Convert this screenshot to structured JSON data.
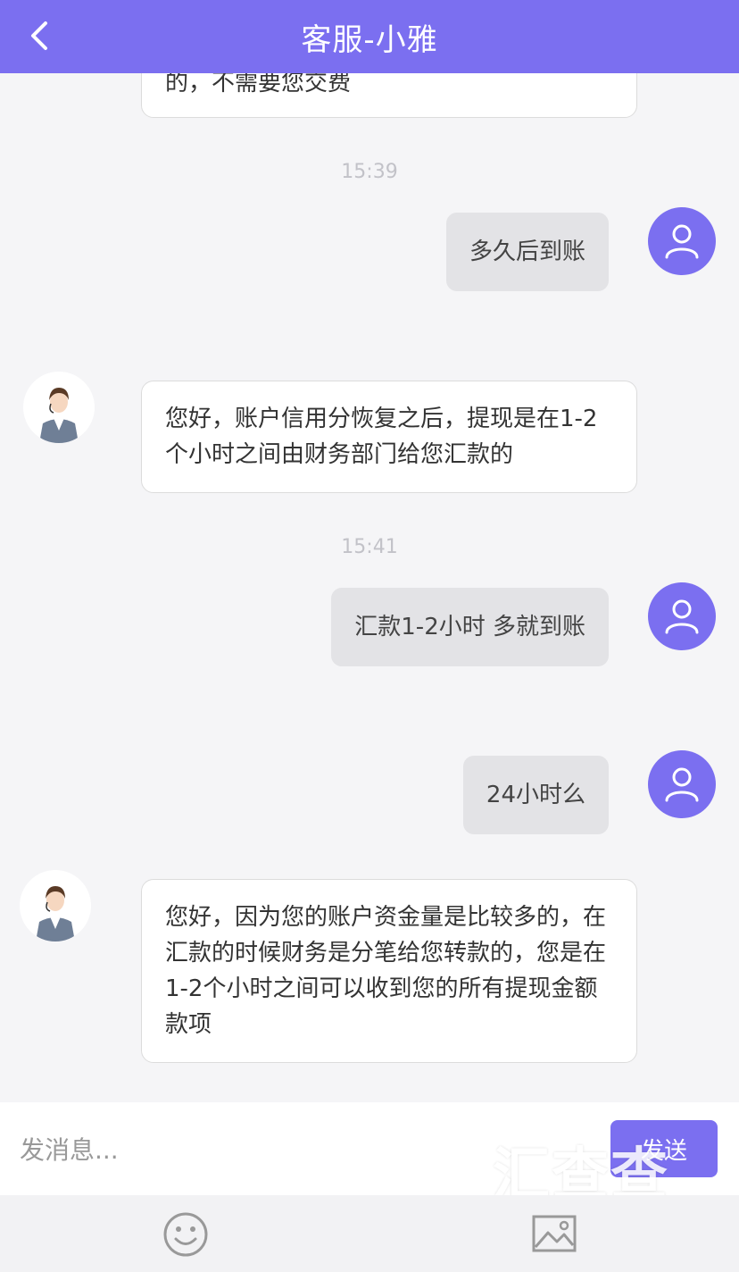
{
  "header": {
    "title": "客服-小雅"
  },
  "messages": {
    "m1": {
      "text": "的，不需要您交费"
    },
    "t1": "15:39",
    "m2": {
      "text": "多久后到账"
    },
    "m3": {
      "text": "您好，账户信用分恢复之后，提现是在1-2个小时之间由财务部门给您汇款的"
    },
    "t2": "15:41",
    "m4": {
      "text": "汇款1-2小时 多就到账"
    },
    "m5": {
      "text": "24小时么"
    },
    "m6": {
      "text": "您好，因为您的账户资金量是比较多的，在汇款的时候财务是分笔给您转款的，您是在1-2个小时之间可以收到您的所有提现金额款项"
    }
  },
  "input": {
    "placeholder": "发消息...",
    "send_label": "发送"
  },
  "watermark": {
    "text": "汇查查"
  },
  "colors": {
    "accent": "#7b6ff0",
    "background": "#f5f5f7",
    "outgoing_bubble": "#e3e3e6"
  },
  "icons": {
    "back": "chevron-left-icon",
    "user": "user-icon",
    "emoji": "emoji-icon",
    "image": "image-icon"
  }
}
